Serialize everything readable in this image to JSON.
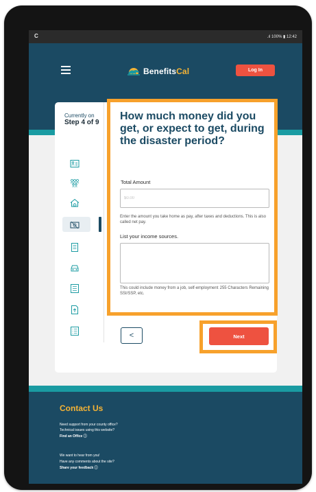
{
  "status_bar": {
    "left_icon": "C",
    "right_text": "100% ▮ 12:42"
  },
  "header": {
    "logo_word": "Benefits",
    "logo_word_accent": "Cal",
    "login_label": "Log In"
  },
  "stepper": {
    "currently_on": "Currently on",
    "step_label": "Step 4 of 9",
    "icons": [
      "id-card-icon",
      "people-icon",
      "house-icon",
      "money-icon",
      "document-icon",
      "car-icon",
      "list-icon",
      "upload-icon",
      "checklist-icon"
    ]
  },
  "form": {
    "question": "How much money did you get, or expect to get, during the disaster period?",
    "total_amount_label": "Total Amount",
    "total_amount_placeholder": "$0.00",
    "total_amount_helper": "Enter the amount you take home as pay, after taxes and deductions. This is also called net pay.",
    "sources_label": "List your income sources.",
    "sources_helper": "This could include money from a job, self-employment, unemployment benefits, SSI/SSP, etc.",
    "char_remaining": "255 Characters Remaining"
  },
  "nav": {
    "back_label": "<",
    "next_label": "Next"
  },
  "footer": {
    "contact_title": "Contact Us",
    "line1": "Need support from your county office?",
    "line2": "Technical issues using this website?",
    "find_office": "Find an Office",
    "line3": "We want to hear from you!",
    "line4": "Have any comments about the site?",
    "share_feedback": "Share your feedback"
  },
  "colors": {
    "primary": "#1b4a63",
    "accent_teal": "#1a9ba2",
    "button_red": "#ee5240",
    "highlight_orange": "#f7a12c",
    "gold": "#f5b335"
  }
}
